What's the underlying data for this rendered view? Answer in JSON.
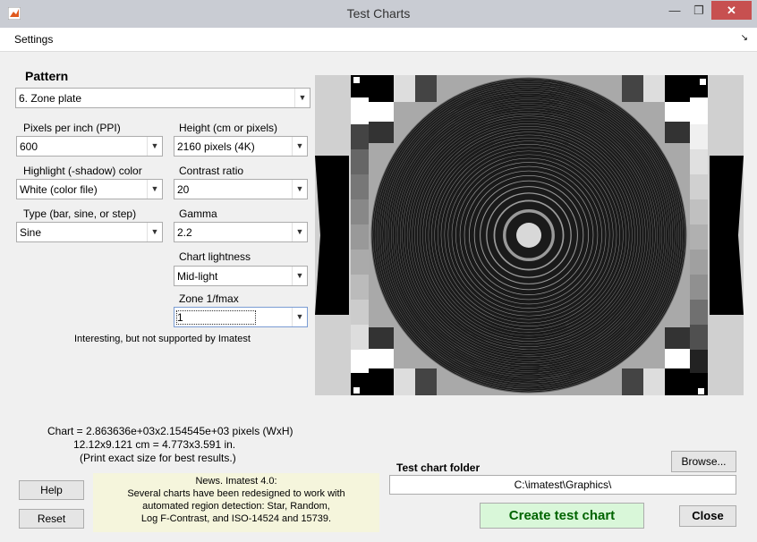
{
  "window": {
    "title": "Test Charts",
    "min_label": "—",
    "max_label": "❐",
    "close_label": "✕"
  },
  "menu": {
    "settings": "Settings",
    "collapse": "↘"
  },
  "pattern": {
    "heading": "Pattern",
    "selected": "6.   Zone plate"
  },
  "fields": {
    "ppi_label": "Pixels per inch (PPI)",
    "ppi_value": "600",
    "height_label": "Height (cm or pixels)",
    "height_value": "2160 pixels (4K)",
    "highlight_label": "Highlight (-shadow) color",
    "highlight_value": "White  (color file)",
    "contrast_label": "Contrast ratio",
    "contrast_value": "20",
    "type_label": "Type (bar, sine, or step)",
    "type_value": "Sine",
    "gamma_label": "Gamma",
    "gamma_value": "2.2",
    "lightness_label": "Chart lightness",
    "lightness_value": "Mid-light",
    "zone_label": "Zone 1/fmax",
    "zone_value": "1"
  },
  "notes": {
    "imatest_note": "Interesting, but not supported by Imatest",
    "chart_line1": "Chart = 2.863636e+03x2.154545e+03 pixels (WxH)",
    "chart_line2": "12.12x9.121 cm = 4.773x3.591 in.",
    "chart_line3": "(Print exact size for best results.)"
  },
  "news": {
    "line1": "News.    Imatest 4.0:",
    "line2": "Several charts have been redesigned to work with",
    "line3": "automated region detection:  Star, Random,",
    "line4": "Log F-Contrast, and  ISO-14524 and 15739."
  },
  "folder": {
    "label": "Test chart folder",
    "path": "C:\\imatest\\Graphics\\"
  },
  "buttons": {
    "help": "Help",
    "reset": "Reset",
    "browse": "Browse...",
    "create": "Create test chart",
    "close": "Close"
  },
  "colors": {
    "create_button": "#d9f7d9",
    "create_text": "#006400",
    "news_background": "#f5f5dc"
  }
}
